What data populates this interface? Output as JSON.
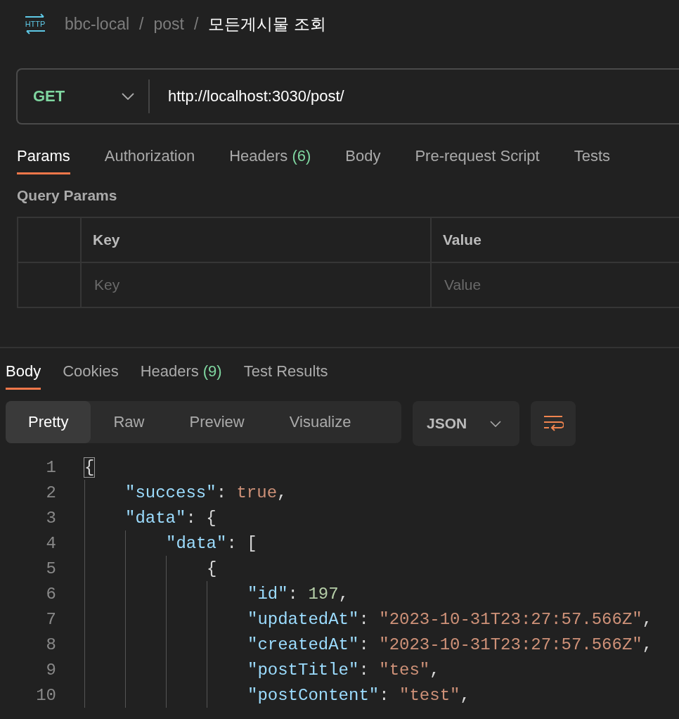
{
  "breadcrumb": {
    "badge": "HTTP",
    "items": [
      "bbc-local",
      "post",
      "모든게시물 조회"
    ],
    "separator": "/"
  },
  "request": {
    "method": "GET",
    "url": "http://localhost:3030/post/"
  },
  "request_tabs": [
    {
      "label": "Params",
      "selected": true
    },
    {
      "label": "Authorization",
      "selected": false
    },
    {
      "label": "Headers",
      "count": "(6)",
      "selected": false
    },
    {
      "label": "Body",
      "selected": false
    },
    {
      "label": "Pre-request Script",
      "selected": false
    },
    {
      "label": "Tests",
      "selected": false
    }
  ],
  "query_params": {
    "title": "Query Params",
    "columns": [
      "Key",
      "Value"
    ],
    "placeholders": [
      "Key",
      "Value"
    ]
  },
  "response_tabs": [
    {
      "label": "Body",
      "selected": true
    },
    {
      "label": "Cookies",
      "selected": false
    },
    {
      "label": "Headers",
      "count": "(9)",
      "selected": false
    },
    {
      "label": "Test Results",
      "selected": false
    }
  ],
  "view_modes": [
    {
      "label": "Pretty",
      "selected": true
    },
    {
      "label": "Raw",
      "selected": false
    },
    {
      "label": "Preview",
      "selected": false
    },
    {
      "label": "Visualize",
      "selected": false
    }
  ],
  "format": "JSON",
  "code": [
    {
      "number": "1",
      "tokens": [
        {
          "kind": "punct",
          "text": "{",
          "matched": true
        }
      ],
      "children": [
        {
          "number": "2",
          "tokens": [
            {
              "kind": "key",
              "text": "\"success\""
            },
            {
              "kind": "punct",
              "text": ": "
            },
            {
              "kind": "bool",
              "text": "true"
            },
            {
              "kind": "punct",
              "text": ","
            }
          ]
        },
        {
          "number": "3",
          "tokens": [
            {
              "kind": "key",
              "text": "\"data\""
            },
            {
              "kind": "punct",
              "text": ": {"
            }
          ],
          "children": [
            {
              "number": "4",
              "tokens": [
                {
                  "kind": "key",
                  "text": "\"data\""
                },
                {
                  "kind": "punct",
                  "text": ": ["
                }
              ],
              "children": [
                {
                  "number": "5",
                  "tokens": [
                    {
                      "kind": "punct",
                      "text": "{"
                    }
                  ],
                  "children": [
                    {
                      "number": "6",
                      "tokens": [
                        {
                          "kind": "key",
                          "text": "\"id\""
                        },
                        {
                          "kind": "punct",
                          "text": ": "
                        },
                        {
                          "kind": "num",
                          "text": "197"
                        },
                        {
                          "kind": "punct",
                          "text": ","
                        }
                      ]
                    },
                    {
                      "number": "7",
                      "tokens": [
                        {
                          "kind": "key",
                          "text": "\"updatedAt\""
                        },
                        {
                          "kind": "punct",
                          "text": ": "
                        },
                        {
                          "kind": "str",
                          "text": "\"2023-10-31T23:27:57.566Z\""
                        },
                        {
                          "kind": "punct",
                          "text": ","
                        }
                      ]
                    },
                    {
                      "number": "8",
                      "tokens": [
                        {
                          "kind": "key",
                          "text": "\"createdAt\""
                        },
                        {
                          "kind": "punct",
                          "text": ": "
                        },
                        {
                          "kind": "str",
                          "text": "\"2023-10-31T23:27:57.566Z\""
                        },
                        {
                          "kind": "punct",
                          "text": ","
                        }
                      ]
                    },
                    {
                      "number": "9",
                      "tokens": [
                        {
                          "kind": "key",
                          "text": "\"postTitle\""
                        },
                        {
                          "kind": "punct",
                          "text": ": "
                        },
                        {
                          "kind": "str",
                          "text": "\"tes\""
                        },
                        {
                          "kind": "punct",
                          "text": ","
                        }
                      ]
                    },
                    {
                      "number": "10",
                      "tokens": [
                        {
                          "kind": "key",
                          "text": "\"postContent\""
                        },
                        {
                          "kind": "punct",
                          "text": ": "
                        },
                        {
                          "kind": "str",
                          "text": "\"test\""
                        },
                        {
                          "kind": "punct",
                          "text": ","
                        }
                      ]
                    }
                  ]
                }
              ]
            }
          ]
        }
      ]
    }
  ]
}
